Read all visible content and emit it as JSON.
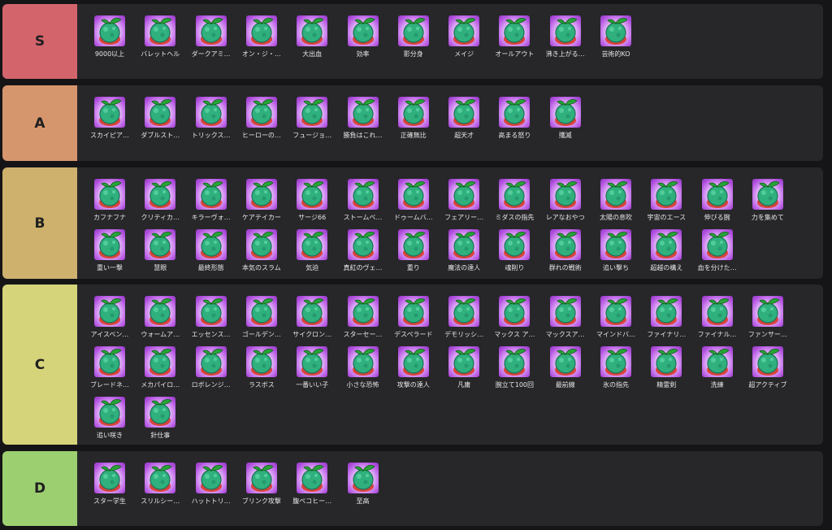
{
  "tiers": [
    {
      "label": "S",
      "color": "#d4646b",
      "items": [
        "9000以上",
        "バレットヘル",
        "ダークアミ…",
        "オン・ジ・…",
        "大出血",
        "効率",
        "影分身",
        "メイジ",
        "オールアウト",
        "沸き上がる…",
        "芸術的KO"
      ]
    },
    {
      "label": "A",
      "color": "#d6966d",
      "items": [
        "スカイピア…",
        "ダブルスト…",
        "トリックス…",
        "ヒーローの…",
        "フュージョ…",
        "勝負はこれ…",
        "正確無比",
        "超天才",
        "高まる怒り",
        "殲滅"
      ]
    },
    {
      "label": "B",
      "color": "#cdb16d",
      "items": [
        "カフナフナ",
        "クリティカ…",
        "キラーヴォ…",
        "ケアテイカー",
        "サージ66",
        "ストームベ…",
        "ドゥームバ…",
        "フェアリー…",
        "ミダスの指先",
        "レアなおやつ",
        "太陽の息吹",
        "宇宙のエース",
        "伸びる腕",
        "力を集めて",
        "重い一撃",
        "慧眼",
        "最終形態",
        "本気のスラム",
        "気迫",
        "真紅のヴェ…",
        "重り",
        "魔法の達人",
        "魂削り",
        "群れの戦術",
        "追い撃ち",
        "超越の構え",
        "血を分けた…"
      ]
    },
    {
      "label": "C",
      "color": "#d6d47a",
      "items": [
        "アイスベン…",
        "ウォームア…",
        "エッセンス…",
        "ゴールデン…",
        "サイクロン…",
        "スターセー…",
        "デスペラード",
        "デモリッシ…",
        "マックス ア…",
        "マックスア…",
        "マインドバ…",
        "ファイナリ…",
        "ファイナル…",
        "ファンサー…",
        "ブレードネ…",
        "メカパイロ…",
        "ロボレンジ…",
        "ラスボス",
        "一番いい子",
        "小さな恐怖",
        "攻撃の達人",
        "凡庸",
        "腕立て100回",
        "最前線",
        "氷の指先",
        "精霊剣",
        "洗練",
        "超アクティブ",
        "追い咲き",
        "針仕事"
      ]
    },
    {
      "label": "D",
      "color": "#9ccf70",
      "items": [
        "スター学生",
        "スリルシー…",
        "ハットトリ…",
        "ブリンク攻撃",
        "腹ペコヒー…",
        "至高"
      ]
    }
  ],
  "icon": {
    "name": "fruit-icon",
    "fruit_color": "#2fb07d",
    "leaf_color": "#27a338",
    "base_color": "#d9443a"
  }
}
